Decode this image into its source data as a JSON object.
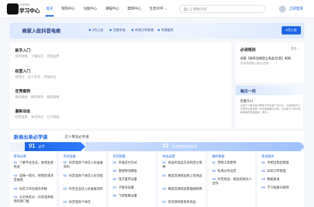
{
  "nav": {
    "logo_small": "抖音电商",
    "logo_name": "学习中心",
    "items": [
      "首页",
      "规则中心",
      "功能中心",
      "课程中心",
      "案例中心",
      "生态伙伴 ⌄"
    ],
    "search_placeholder": "Q 搜索内容",
    "login": "立即登录"
  },
  "banner": {
    "title": "商家入驻抖音电商",
    "pills": [
      "0元入驻",
      "流量补贴",
      "商城订单免佣",
      "专属服务"
    ],
    "button": "0元入驻"
  },
  "left_sections": [
    {
      "title": "新手入门",
      "links": [
        "开单攻略",
        "了解抖店",
        "货架运营"
      ]
    },
    {
      "title": "经营入门",
      "links": [
        "经营力",
        "达人带货",
        "店铺优化"
      ]
    },
    {
      "title": "优秀案例",
      "links": [
        "服饰发展",
        "服饰男装",
        "服饰轻奢"
      ]
    },
    {
      "title": "最新动态",
      "links": [
        "经营指南",
        "本月热点",
        "七夕情报"
      ]
    }
  ],
  "rules_card": {
    "title": "必读规则",
    "more": "更多 ›",
    "rule_title": "商家【发布违规禁止商品/信息】规则",
    "rule_sub": "发布违规禁止商品/信息"
  },
  "daily_card": {
    "title": "每日一词",
    "word": "巨量千川",
    "body": "巨量千川是巨量引擎旗下的电商广告平台，为商家和达人们提供抖音电商一体化营销解决方案。平台致力于成为电商商家的智能营销... 更多 ›"
  },
  "learn": {
    "title": "新商出单必学课",
    "subtitle": "达人带货必学课",
    "step1_num": "01",
    "step1_label": "必学",
    "step2_num": "02",
    "step2_label": "新商经营动作指南"
  },
  "columns": [
    {
      "title": "新商必看",
      "items": [
        {
          "n": "01",
          "t": "了解平台生态，发现生意机会"
        },
        {
          "n": "02",
          "t": "选择一努力，经营前请决定规则"
        },
        {
          "n": "03",
          "t": "抖店工作台操作手册"
        },
        {
          "n": "04",
          "t": "认识体验分：抖音电商经营的第门槛"
        }
      ]
    },
    {
      "title": "开店准备",
      "items": [
        {
          "n": "01",
          "t": "抖音电商个体店入驻准备资料"
        },
        {
          "n": "02",
          "t": "抖音电商个体店入驻流程"
        },
        {
          "n": "03",
          "t": "抖音企业店入驻准备资料"
        },
        {
          "n": "04",
          "t": "抖音电商个体店"
        }
      ]
    },
    {
      "title": "开店配置",
      "items": [
        {
          "n": "01",
          "t": "开通支付方式"
        },
        {
          "n": "02",
          "t": "基础物流模板"
        },
        {
          "n": "03",
          "t": "电子面单设置"
        },
        {
          "n": "04",
          "t": "子账号设置"
        },
        {
          "n": "05",
          "t": "飞鸽客服设置"
        }
      ]
    },
    {
      "title": "商品运营",
      "items": [
        {
          "n": "01",
          "t": "商品的选品方法和定价策略"
        },
        {
          "n": "02",
          "t": "精选货源商品和上架商品"
        },
        {
          "n": "03",
          "t": "精选货源商品管理规则简"
        },
        {
          "n": "04",
          "t": "有货源商家发布商品"
        }
      ]
    },
    {
      "title": "做好数据",
      "items": [
        {
          "n": "01",
          "t": "营销工具使用"
        },
        {
          "n": "02",
          "t": "私域分享设定"
        },
        {
          "n": "03",
          "t": "抖音商品：挑选优质达人合作"
        }
      ]
    },
    {
      "title": "售后服务",
      "items": [
        {
          "n": "01",
          "t": "手把出售后管理"
        },
        {
          "n": "02",
          "t": "异常订单管理"
        },
        {
          "n": "03",
          "t": "数据复盘"
        },
        {
          "n": "04",
          "t": "学习准备分规则"
        }
      ]
    }
  ]
}
